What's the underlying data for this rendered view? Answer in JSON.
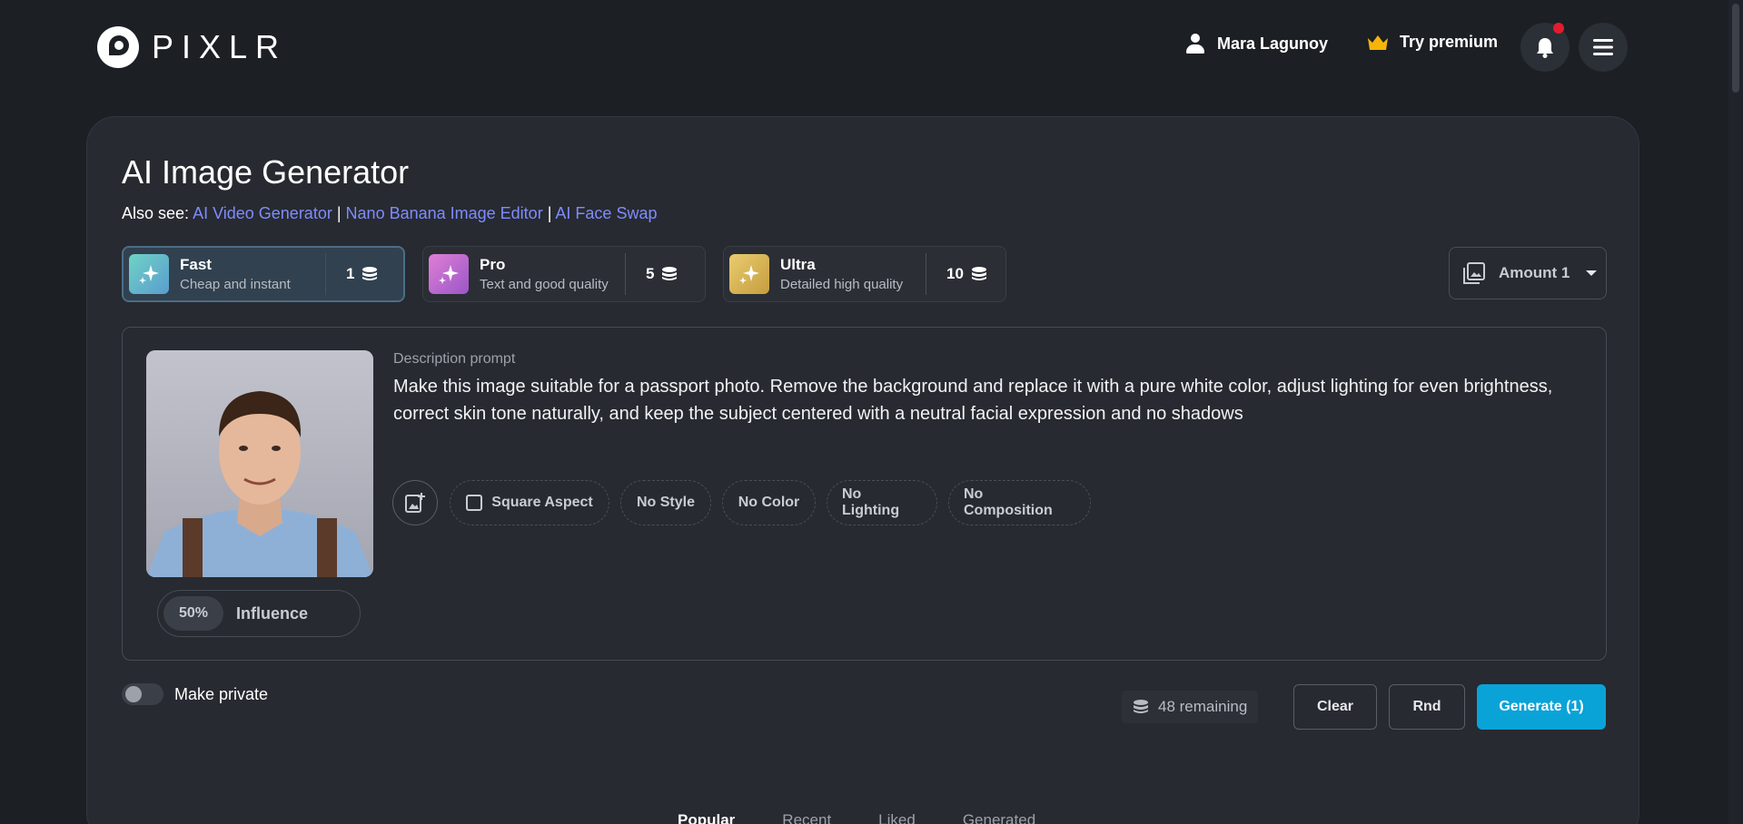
{
  "header": {
    "logo_text": "PIXLR",
    "user_name": "Mara Lagunoy",
    "premium_label": "Try premium"
  },
  "page": {
    "title": "AI Image Generator",
    "also_see_label": "Also see:",
    "links": [
      "AI Video Generator",
      "Nano Banana Image Editor",
      "AI Face Swap"
    ],
    "separator": "|"
  },
  "models": [
    {
      "name": "Fast",
      "subtitle": "Cheap and instant",
      "cost": "1",
      "selected": true
    },
    {
      "name": "Pro",
      "subtitle": "Text and good quality",
      "cost": "5",
      "selected": false
    },
    {
      "name": "Ultra",
      "subtitle": "Detailed high quality",
      "cost": "10",
      "selected": false
    }
  ],
  "amount": {
    "label": "Amount 1"
  },
  "prompt": {
    "label": "Description prompt",
    "text": "Make this image suitable for a passport photo. Remove the background and replace it with a pure white color, adjust lighting for even brightness, correct skin tone naturally, and keep the subject centered with a neutral facial expression and no shadows"
  },
  "influence": {
    "percent": "50%",
    "label": "Influence"
  },
  "chips": [
    "Square Aspect",
    "No Style",
    "No Color",
    "No Lighting",
    "No Composition"
  ],
  "footer": {
    "private_label": "Make private",
    "remaining": "48 remaining",
    "clear": "Clear",
    "rnd": "Rnd",
    "generate": "Generate (1)"
  },
  "tabs": [
    {
      "label": "Popular",
      "active": true
    },
    {
      "label": "Recent",
      "active": false
    },
    {
      "label": "Liked",
      "active": false
    },
    {
      "label": "Generated",
      "active": false
    }
  ],
  "colors": {
    "accent": "#0aa3d8",
    "link": "#7f8cff",
    "notif": "#e21d2d"
  }
}
